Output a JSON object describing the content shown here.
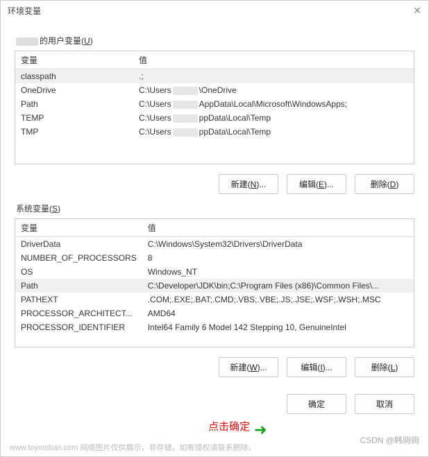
{
  "window": {
    "title": "环境变量"
  },
  "user_section": {
    "label_prefix": "的用户变量(",
    "label_key": "U",
    "label_suffix": ")"
  },
  "user_table": {
    "header_name": "变量",
    "header_value": "值",
    "rows": [
      {
        "name": "classpath",
        "value": ".;",
        "selected": true
      },
      {
        "name": "OneDrive",
        "value_pre": "C:\\Users",
        "value_post": "\\OneDrive",
        "blurred": true
      },
      {
        "name": "Path",
        "value_pre": "C:\\Users",
        "value_post": "AppData\\Local\\Microsoft\\WindowsApps;",
        "blurred": true
      },
      {
        "name": "TEMP",
        "value_pre": "C:\\Users",
        "value_post": "ppData\\Local\\Temp",
        "blurred": true
      },
      {
        "name": "TMP",
        "value_pre": "C:\\Users",
        "value_post": "ppData\\Local\\Temp",
        "blurred": true
      }
    ]
  },
  "user_buttons": {
    "new": {
      "text": "新建(",
      "key": "N",
      "suffix": ")..."
    },
    "edit": {
      "text": "编辑(",
      "key": "E",
      "suffix": ")..."
    },
    "delete": {
      "text": "删除(",
      "key": "D",
      "suffix": ")"
    }
  },
  "system_section": {
    "label": "系统变量(",
    "label_key": "S",
    "label_suffix": ")"
  },
  "system_table": {
    "header_name": "变量",
    "header_value": "值",
    "rows": [
      {
        "name": "DriverData",
        "value": "C:\\Windows\\System32\\Drivers\\DriverData"
      },
      {
        "name": "NUMBER_OF_PROCESSORS",
        "value": "8"
      },
      {
        "name": "OS",
        "value": "Windows_NT"
      },
      {
        "name": "Path",
        "value": "C:\\Developer\\JDK\\bin;C:\\Program Files (x86)\\Common Files\\...",
        "selected": true
      },
      {
        "name": "PATHEXT",
        "value": ".COM;.EXE;.BAT;.CMD;.VBS;.VBE;.JS;.JSE;.WSF;.WSH;.MSC"
      },
      {
        "name": "PROCESSOR_ARCHITECT...",
        "value": "AMD64"
      },
      {
        "name": "PROCESSOR_IDENTIFIER",
        "value": "Intel64 Family 6 Model 142 Stepping 10, GenuineIntel"
      }
    ]
  },
  "system_buttons": {
    "new": {
      "text": "新建(",
      "key": "W",
      "suffix": ")..."
    },
    "edit": {
      "text": "编辑(",
      "key": "I",
      "suffix": ")..."
    },
    "delete": {
      "text": "删除(",
      "key": "L",
      "suffix": ")"
    }
  },
  "dialog_buttons": {
    "ok": "确定",
    "cancel": "取消"
  },
  "annotation": {
    "text": "点击确定"
  },
  "watermarks": {
    "left": "www.toymoban.com 网络图片仅供展示，非存储，如有侵权请联系删除。",
    "right": "CSDN @韩驹驹"
  }
}
